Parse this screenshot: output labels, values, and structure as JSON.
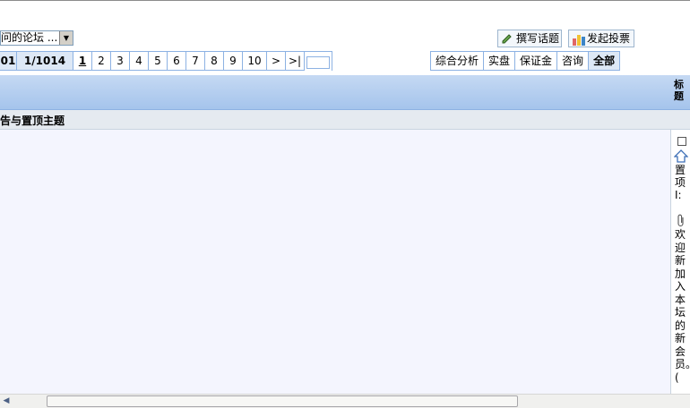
{
  "forum_select": {
    "value": "问的论坛 ..."
  },
  "toolbar": {
    "write_label": "撰写话题",
    "vote_label": "发起投票"
  },
  "pager": {
    "count": "01",
    "page_info": "1/1014",
    "pages": [
      "1",
      "2",
      "3",
      "4",
      "5",
      "6",
      "7",
      "8",
      "9",
      "10"
    ],
    "current": "1",
    "next": ">",
    "last": ">|"
  },
  "categories": [
    "综合分析",
    "实盘",
    "保证金",
    "咨询",
    "全部"
  ],
  "active_category": "全部",
  "column_header": {
    "title": "标题"
  },
  "section": {
    "title": "告与置顶主题"
  },
  "topic": {
    "prefix": "置项I:",
    "text": "欢迎新加入本坛的新会员。("
  }
}
